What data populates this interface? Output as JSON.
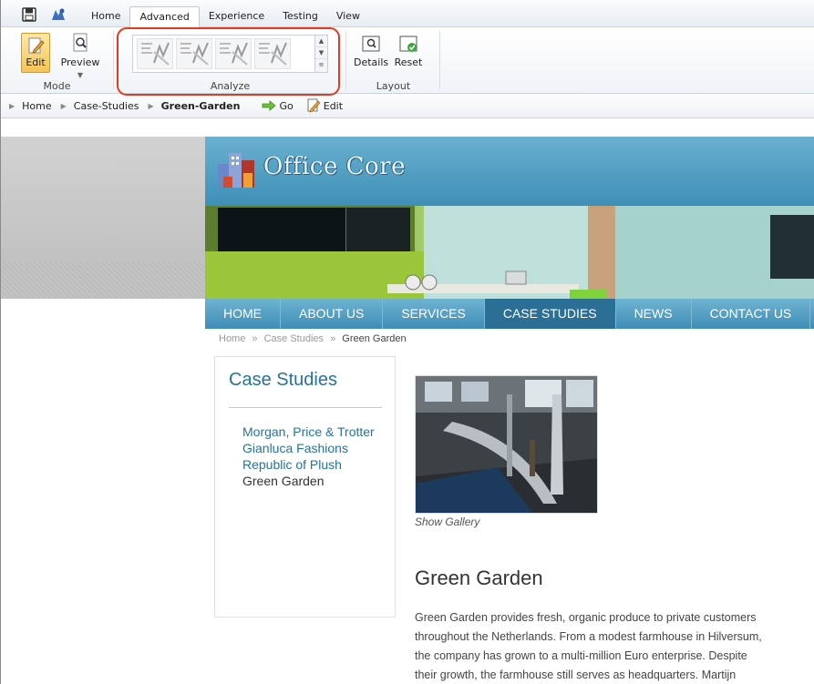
{
  "ribbon": {
    "tabs": [
      "Home",
      "Advanced",
      "Experience",
      "Testing",
      "View"
    ],
    "active_tab": "Advanced",
    "mode": {
      "label": "Mode",
      "edit": "Edit",
      "preview": "Preview"
    },
    "analyze": {
      "label": "Analyze"
    },
    "layout": {
      "label": "Layout",
      "details": "Details",
      "reset": "Reset"
    }
  },
  "address_bar": {
    "crumbs": [
      "Home",
      "Case-Studies",
      "Green-Garden"
    ],
    "go": "Go",
    "edit": "Edit"
  },
  "site": {
    "logo": "Office Core",
    "nav": [
      "HOME",
      "ABOUT US",
      "SERVICES",
      "CASE STUDIES",
      "NEWS",
      "CONTACT US"
    ],
    "active_nav": "CASE STUDIES",
    "breadcrumb": {
      "home": "Home",
      "sep": "»",
      "section": "Case Studies",
      "current": "Green Garden"
    },
    "sidebar": {
      "title": "Case Studies",
      "items": [
        "Morgan, Price & Trotter",
        "Gianluca Fashions",
        "Republic of Plush",
        "Green Garden"
      ],
      "current": "Green Garden"
    },
    "show_gallery": "Show Gallery",
    "heading": "Green Garden",
    "body_lines": [
      "Green Garden provides fresh, organic produce to private customers",
      "throughout the Netherlands. From a modest farmhouse in Hilversum,",
      "the company has grown to a multi-million Euro enterprise. Despite",
      "their growth, the farmhouse still serves as headquarters. Martijn"
    ]
  },
  "colors": {
    "accent_blue": "#2673a0",
    "nav_blue": "#3f8db6",
    "highlight_red": "#e53a1f"
  }
}
